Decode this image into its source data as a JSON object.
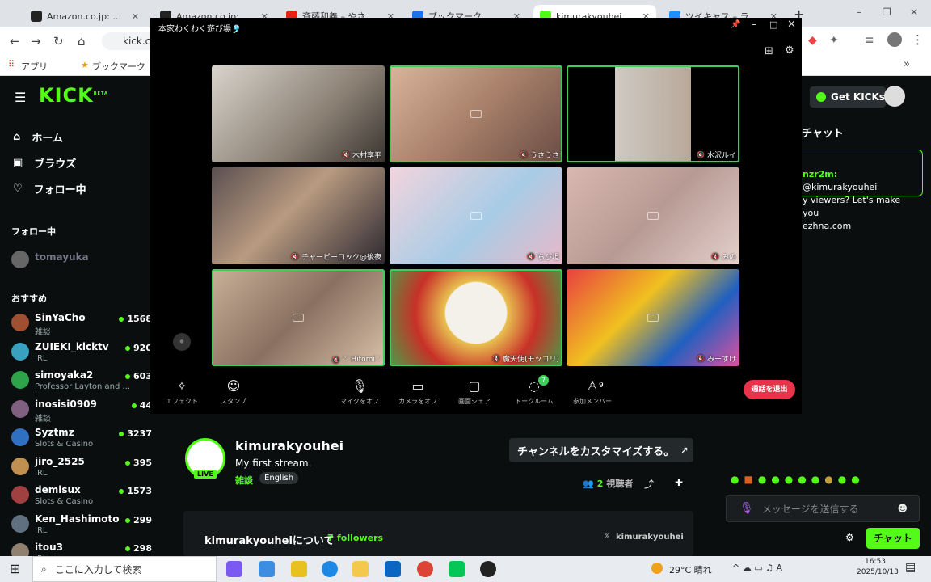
{
  "browser": {
    "tabs": [
      {
        "title": "Amazon.co.jp: SPY×FAM",
        "color": "#222"
      },
      {
        "title": "Amazon.co.jp: 滑於着水",
        "color": "#222"
      },
      {
        "title": "斉藤和義 – やさしくなりたい",
        "color": "#e62117"
      },
      {
        "title": "ブックマーク",
        "color": "#1a73e8"
      },
      {
        "title": "kimurakyouhei Stream",
        "color": "#53fc18"
      },
      {
        "title": "ツイキャス – ライブでつなが",
        "color": "#1e90ff"
      }
    ],
    "address": "kick.co",
    "bookmarks": [
      "アプリ",
      "ブックマーク"
    ]
  },
  "kick": {
    "logo": "KICK",
    "logo_badge": "BETA",
    "nav": [
      {
        "label": "ホーム",
        "icon": "home-icon"
      },
      {
        "label": "ブラウズ",
        "icon": "browse-icon"
      },
      {
        "label": "フォロー中",
        "icon": "heart-icon"
      }
    ],
    "following_header": "フォロー中",
    "following": [
      {
        "name": "tomayuka"
      }
    ],
    "recommended_header": "おすすめ",
    "recommended": [
      {
        "name": "SinYaCho",
        "category": "雑談",
        "viewers": "1568",
        "color": "#a05030"
      },
      {
        "name": "ZUIEKI_kicktv",
        "category": "IRL",
        "viewers": "920",
        "color": "#3aa0c0"
      },
      {
        "name": "simoyaka2",
        "category": "Professor Layton and ...",
        "viewers": "603",
        "color": "#2fa34a"
      },
      {
        "name": "inosisi0909",
        "category": "雑談",
        "viewers": "44",
        "color": "#806080"
      },
      {
        "name": "Syztmz",
        "category": "Slots & Casino",
        "viewers": "3237",
        "color": "#3070c0"
      },
      {
        "name": "jiro_2525",
        "category": "IRL",
        "viewers": "395",
        "color": "#c09050"
      },
      {
        "name": "demisux",
        "category": "Slots & Casino",
        "viewers": "1573",
        "color": "#a04040"
      },
      {
        "name": "Ken_Hashimoto",
        "category": "IRL",
        "viewers": "299",
        "color": "#607080"
      },
      {
        "name": "itou3",
        "category": "IRL",
        "viewers": "298",
        "color": "#908070"
      }
    ]
  },
  "call": {
    "title": "本家わくわく遊び場🎐",
    "participants": [
      {
        "name": "木村享平",
        "bg": "linear-gradient(135deg,#d8d4cc,#8a7f73 60%,#3a3530)",
        "hl": false,
        "camoff": false
      },
      {
        "name": "うさうさ",
        "bg": "linear-gradient(135deg,#d9b49a,#a8806a 50%,#6a4c44)",
        "hl": true,
        "camoff": true
      },
      {
        "name": "水沢ルイ",
        "bg": "linear-gradient(90deg,#000 28%,#cfc9c2 28%,#b8a89a 72%,#000 72%)",
        "hl": true,
        "camoff": false
      },
      {
        "name": "チャービーロック@後夜",
        "bg": "linear-gradient(135deg,#5a5050,#b89a80 45%,#2c2830)",
        "hl": false,
        "camoff": false
      },
      {
        "name": "ちび坦",
        "bg": "linear-gradient(135deg,#f2d4dc,#a8cce6 55%,#e8b8c8)",
        "hl": false,
        "camoff": true
      },
      {
        "name": "みの",
        "bg": "linear-gradient(135deg,#d8b8b0,#b89a94 50%,#e4d0cc)",
        "hl": false,
        "camoff": true
      },
      {
        "name": "♡ Hitomi♡",
        "bg": "linear-gradient(135deg,#c8b098,#8a7060 50%,#d8c0a8)",
        "hl": true,
        "camoff": true
      },
      {
        "name": "魔天使(モッコリ)",
        "bg": "radial-gradient(circle at 50% 45%,#f4f0ea 30%,#e8c050 31%,#c83028 60%,#48a048)",
        "hl": true,
        "camoff": false
      },
      {
        "name": "みーすけ",
        "bg": "linear-gradient(135deg,#e84040,#f0c020 40%,#2060c0 70%,#e050a0)",
        "hl": false,
        "camoff": true
      }
    ],
    "controls": [
      {
        "label": "エフェクト",
        "icon": "effect-icon"
      },
      {
        "label": "スタンプ",
        "icon": "stamp-icon"
      },
      {
        "label": "マイクをオフ",
        "icon": "mic-icon"
      },
      {
        "label": "カメラをオフ",
        "icon": "camera-icon"
      },
      {
        "label": "画面シェア",
        "icon": "screenshare-icon"
      },
      {
        "label": "トークルーム",
        "icon": "chat-icon"
      },
      {
        "label": "参加メンバー",
        "icon": "members-icon"
      }
    ],
    "chat_badge": "7",
    "member_count": "9",
    "leave_label": "通話を退出"
  },
  "channel": {
    "name": "kimurakyouhei",
    "live_badge": "LIVE",
    "stream_title": "My first stream.",
    "category": "雑談",
    "language": "English",
    "customize_label": "チャンネルをカスタマイズする。",
    "viewer_count": "2",
    "viewer_label": "視聴者",
    "about_label": "kimurakyouheiについて",
    "followers_count": "7",
    "followers_label": "followers",
    "x_handle": "kimurakyouhei"
  },
  "chat": {
    "get_kicks": "Get KICKs",
    "header": "チャット",
    "pinned_user": "nzr2m:",
    "pinned_text": "@kimurakyouhei\ny viewers? Let's make you\nezhna.com",
    "placeholder": "メッセージを送信する",
    "send_label": "チャット"
  },
  "taskbar": {
    "search_placeholder": "ここに入力して検索",
    "weather": "29°C  晴れ",
    "time": "16:53",
    "date": "2025/10/13"
  }
}
